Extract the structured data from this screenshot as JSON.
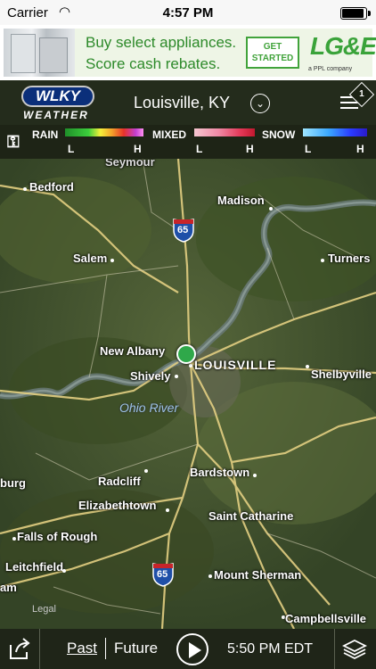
{
  "status_bar": {
    "carrier": "Carrier",
    "time": "4:57 PM",
    "battery_level": 1.0
  },
  "ad": {
    "line1": "Buy select appliances.",
    "line2": "Score cash rebates.",
    "cta": "GET STARTED",
    "logo": "LG&E",
    "logo_tag": "a PPL company"
  },
  "header": {
    "brand_main": "WLKY",
    "brand_sub": "WEATHER",
    "location": "Louisville, KY",
    "menu_badge": "1"
  },
  "legend": {
    "rain": "RAIN",
    "mixed": "MIXED",
    "snow": "SNOW",
    "low": "L",
    "high": "H"
  },
  "map": {
    "places": [
      "Seymour",
      "Bedford",
      "Madison",
      "Salem",
      "Turners",
      "New Albany",
      "LOUISVILLE",
      "Shively",
      "Shelbyville",
      "Ohio River",
      "Bardstown",
      "Radcliff",
      "burg",
      "Elizabethtown",
      "Saint Catharine",
      "Falls of Rough",
      "Leitchfield",
      "Mount Sherman",
      "am",
      "Campbellsville"
    ],
    "highway_shields": [
      "65",
      "65"
    ],
    "legal": "Legal"
  },
  "bottom_bar": {
    "past": "Past",
    "future": "Future",
    "time": "5:50 PM EDT"
  }
}
